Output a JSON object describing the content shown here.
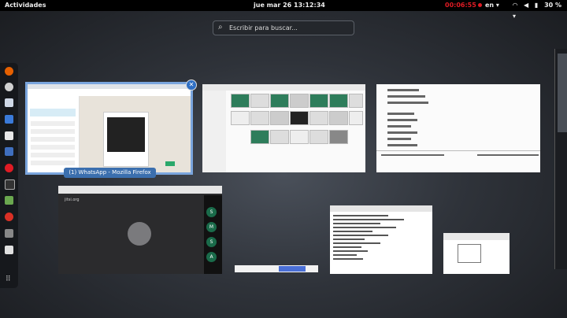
{
  "topbar": {
    "activities": "Actividades",
    "clock": "jue mar 26  13:12:34",
    "recording": "00:06:55",
    "language": "en",
    "wifi_icon": "wifi-icon",
    "volume_icon": "volume-icon",
    "power_icon": "power-icon",
    "battery": "30 %"
  },
  "search": {
    "placeholder": "Escribir para buscar..."
  },
  "dash": {
    "apps": [
      {
        "name": "firefox",
        "color": "#e66000"
      },
      {
        "name": "whatsapp",
        "color": "#d0d0d0"
      },
      {
        "name": "files",
        "color": "#cfd8e6"
      },
      {
        "name": "document",
        "color": "#3a7ad9"
      },
      {
        "name": "editor",
        "color": "#e8e8e8"
      },
      {
        "name": "calculator",
        "color": "#3f6fbf"
      },
      {
        "name": "help",
        "color": "#e01b24"
      },
      {
        "name": "terminal",
        "color": "#333333"
      },
      {
        "name": "monitor",
        "color": "#6aa84f"
      },
      {
        "name": "chrome",
        "color": "#d93025"
      },
      {
        "name": "screenshot",
        "color": "#888888"
      },
      {
        "name": "chat",
        "color": "#e0e0e0"
      }
    ]
  },
  "windows": {
    "selected_caption": "(1) WhatsApp - Mozilla Firefox",
    "meet_site": "jitsi.org",
    "meet_participants": [
      "S",
      "M",
      "S",
      "A"
    ]
  }
}
